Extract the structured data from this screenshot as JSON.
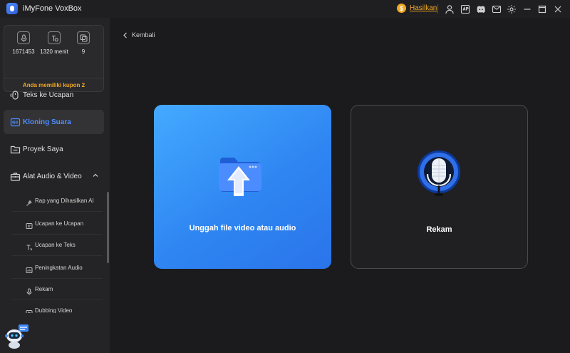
{
  "app": {
    "title": "iMyFone VoxBox"
  },
  "titlebar": {
    "earn_label": "Hasilkan",
    "coin_symbol": "$",
    "icons": [
      "user-icon",
      "app-icon",
      "discord-icon",
      "settings-icon",
      "minimize-icon",
      "maximize-icon",
      "close-icon"
    ]
  },
  "stats": {
    "characters": "1671453",
    "minutes": "1320 menit",
    "count": "9",
    "coupon": "Anda memiliki kupon 2"
  },
  "sidebar": {
    "tts": "Teks ke Ucapan",
    "voice_clone": "Kloning Suara",
    "projects": "Proyek Saya",
    "tools": "Alat Audio & Video",
    "sub": {
      "ai_rap": "Rap yang Dihasilkan AI",
      "speech_to_speech": "Ucapan ke Ucapan",
      "speech_to_text": "Ucapan ke Teks",
      "audio_enhance": "Peningkatan Audio",
      "record": "Rekam",
      "dubbing": "Dubbing Video"
    }
  },
  "main": {
    "back": "Kembali",
    "upload_card": "Unggah file video atau audio",
    "record_card": "Rekam"
  },
  "colors": {
    "accent": "#4d8dff",
    "coupon": "#f0a824",
    "upload_gradient_start": "#44aaff",
    "upload_gradient_end": "#2a74ea"
  }
}
